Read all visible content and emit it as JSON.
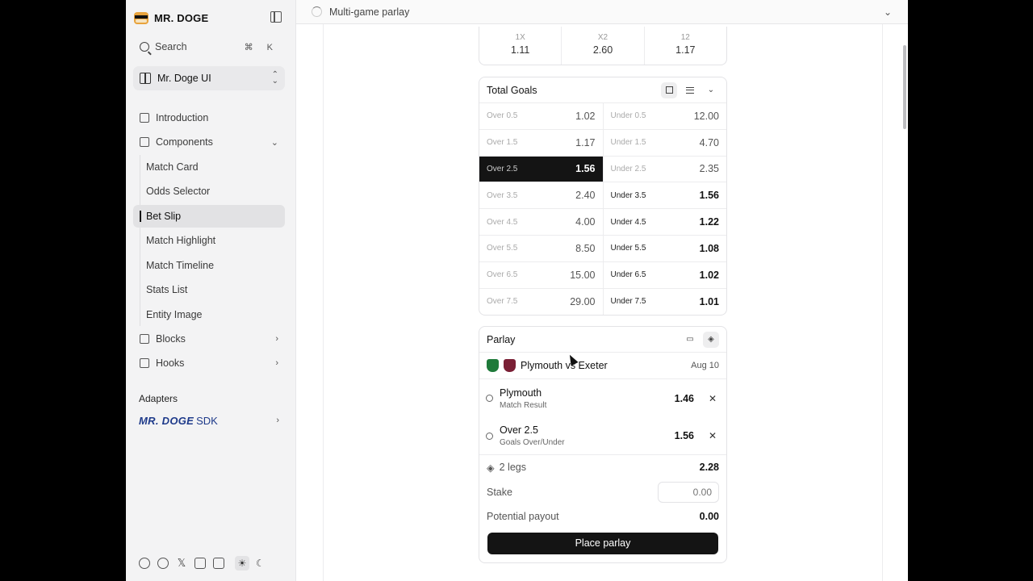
{
  "brand": {
    "name": "MR. DOGE"
  },
  "sidebar": {
    "search": {
      "placeholder": "Search",
      "shortcut": "⌘ K"
    },
    "workspace": {
      "label": "Mr. Doge UI"
    },
    "items": [
      {
        "label": "Introduction",
        "icon": "book-icon"
      },
      {
        "label": "Components",
        "icon": "grid-icon",
        "expanded": true
      },
      {
        "label": "Blocks",
        "icon": "blocks-icon"
      },
      {
        "label": "Hooks",
        "icon": "hook-icon"
      }
    ],
    "components": [
      "Match Card",
      "Odds Selector",
      "Bet Slip",
      "Match Highlight",
      "Match Timeline",
      "Stats List",
      "Entity Image"
    ],
    "active_component": "Bet Slip",
    "section_label": "Adapters",
    "sdk": {
      "brand": "MR. DOGE",
      "suffix": "SDK"
    },
    "footer_icons": [
      "github-icon",
      "reddit-icon",
      "x-icon",
      "linkedin-icon",
      "instagram-icon",
      "sun-icon",
      "moon-icon"
    ]
  },
  "topbar": {
    "title": "Multi-game parlay"
  },
  "double_chance": {
    "options": [
      {
        "label": "1X",
        "odds": "1.11"
      },
      {
        "label": "X2",
        "odds": "2.60"
      },
      {
        "label": "12",
        "odds": "1.17"
      }
    ]
  },
  "total_goals": {
    "title": "Total Goals",
    "rows": [
      {
        "over_label": "Over 0.5",
        "over_odds": "1.02",
        "under_label": "Under 0.5",
        "under_odds": "12.00"
      },
      {
        "over_label": "Over 1.5",
        "over_odds": "1.17",
        "under_label": "Under 1.5",
        "under_odds": "4.70"
      },
      {
        "over_label": "Over 2.5",
        "over_odds": "1.56",
        "under_label": "Under 2.5",
        "under_odds": "2.35"
      },
      {
        "over_label": "Over 3.5",
        "over_odds": "2.40",
        "under_label": "Under 3.5",
        "under_odds": "1.56"
      },
      {
        "over_label": "Over 4.5",
        "over_odds": "4.00",
        "under_label": "Under 4.5",
        "under_odds": "1.22"
      },
      {
        "over_label": "Over 5.5",
        "over_odds": "8.50",
        "under_label": "Under 5.5",
        "under_odds": "1.08"
      },
      {
        "over_label": "Over 6.5",
        "over_odds": "15.00",
        "under_label": "Under 6.5",
        "under_odds": "1.02"
      },
      {
        "over_label": "Over 7.5",
        "over_odds": "29.00",
        "under_label": "Under 7.5",
        "under_odds": "1.01"
      }
    ],
    "selected": "Over 2.5"
  },
  "parlay": {
    "title": "Parlay",
    "match": {
      "teams": "Plymouth vs Exeter",
      "date": "Aug 10"
    },
    "legs": [
      {
        "title": "Plymouth",
        "market": "Match Result",
        "odds": "1.46"
      },
      {
        "title": "Over 2.5",
        "market": "Goals Over/Under",
        "odds": "1.56"
      }
    ],
    "legs_label": "2 legs",
    "combined_odds": "2.28",
    "stake_label": "Stake",
    "stake_placeholder": "0.00",
    "payout_label": "Potential payout",
    "payout_value": "0.00",
    "button_label": "Place parlay"
  }
}
